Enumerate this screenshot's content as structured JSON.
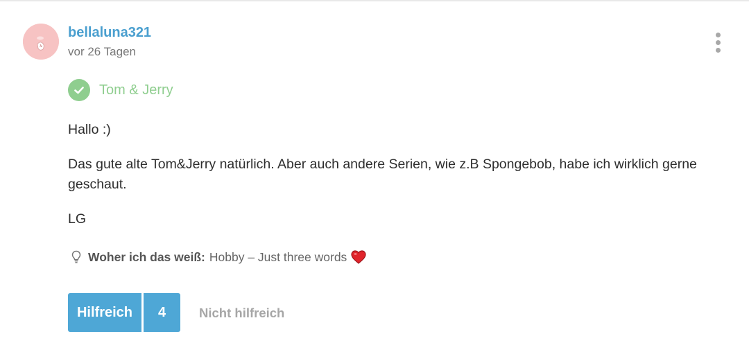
{
  "post": {
    "author": "bellaluna321",
    "time": "vor 26 Tagen",
    "answer_tag": "Tom & Jerry",
    "paragraphs": [
      "Hallo :)",
      "Das gute alte Tom&Jerry natürlich. Aber auch andere Serien, wie z.B Spongebob, habe ich wirklich gerne geschaut.",
      "LG"
    ]
  },
  "source": {
    "label": "Woher ich das weiß:",
    "value": "Hobby – Just three words"
  },
  "voting": {
    "helpful_label": "Hilfreich",
    "helpful_count": "4",
    "unhelpful_label": "Nicht hilfreich"
  },
  "icons": {
    "more": "more-vertical-icon",
    "check": "check-circle-icon",
    "bulb": "lightbulb-icon",
    "heart": "heart-emoji-icon"
  },
  "colors": {
    "link": "#4a9fcf",
    "check_green": "#8fce8f",
    "button_blue": "#4ea7d6",
    "muted_gray": "#a6a6a6",
    "avatar_pink": "#f7c3c3",
    "heart_red": "#e0242b"
  }
}
